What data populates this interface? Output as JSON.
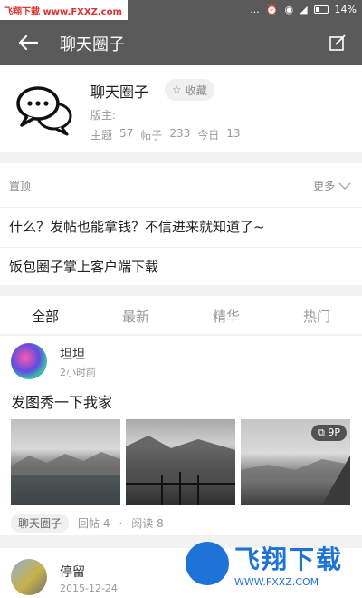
{
  "status_bar": {
    "watermark": "飞翔下载 www.FXXZ.com",
    "dots": "...",
    "battery": "14%"
  },
  "app_bar": {
    "title": "聊天圈子"
  },
  "forum": {
    "name": "聊天圈子",
    "favorite_label": "收藏",
    "moderator_label": "版主:",
    "stats": {
      "topics_label": "主题",
      "topics": "57",
      "posts_label": "帖子",
      "posts": "233",
      "today_label": "今日",
      "today": "13"
    }
  },
  "pinned": {
    "label": "置顶",
    "more_label": "更多",
    "items": [
      "什么？发帖也能拿钱？不信进来就知道了~",
      "饭包圈子掌上客户端下载"
    ]
  },
  "tabs": [
    {
      "label": "全部",
      "active": true
    },
    {
      "label": "最新",
      "active": false
    },
    {
      "label": "精华",
      "active": false
    },
    {
      "label": "热门",
      "active": false
    }
  ],
  "posts": [
    {
      "author": "坦坦",
      "time": "2小时前",
      "text": "发图秀一下我家",
      "image_count_badge": "9P",
      "forum_tag": "聊天圈子",
      "replies": "回帖 4",
      "separator": "·",
      "reads": "阅读 8"
    },
    {
      "author": "停留",
      "time": "2015-12-24"
    }
  ],
  "watermark": {
    "brand": "飞翔下载",
    "url": "WWW.FXXZ.COM"
  }
}
